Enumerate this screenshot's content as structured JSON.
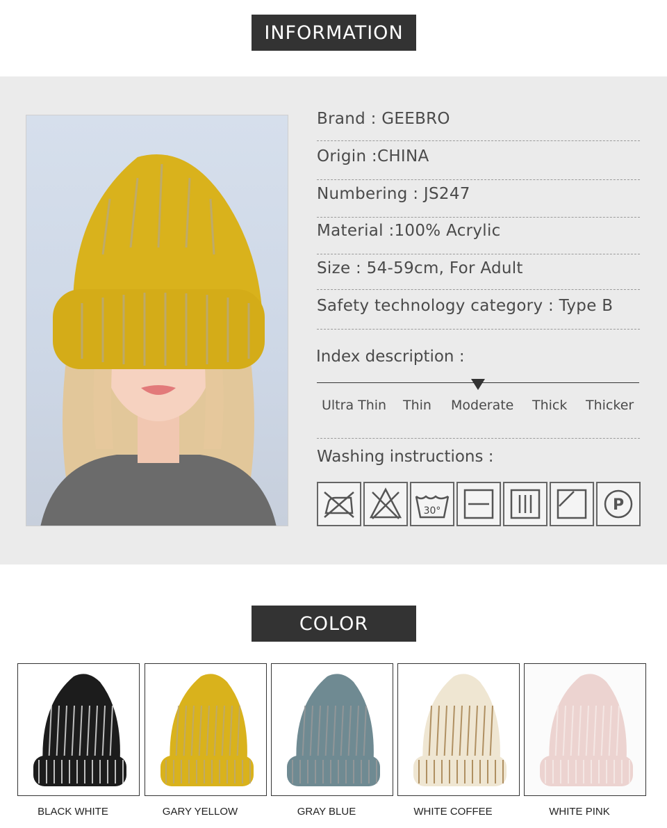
{
  "info_heading": "INFORMATION",
  "color_heading": "COLOR",
  "specs": [
    {
      "label": "Brand : GEEBRO"
    },
    {
      "label": "Origin :CHINA"
    },
    {
      "label": "Numbering : JS247"
    },
    {
      "label": "Material :100% Acrylic"
    },
    {
      "label": "Size : 54-59cm, For Adult"
    },
    {
      "label": "Safety technology category : Type B"
    }
  ],
  "index": {
    "title": "Index description :",
    "levels": [
      "Ultra Thin",
      "Thin",
      "Moderate",
      "Thick",
      "Thicker"
    ],
    "selected": "Moderate"
  },
  "washing": {
    "title": "Washing instructions :",
    "icons": [
      {
        "name": "do-not-iron-icon"
      },
      {
        "name": "do-not-bleach-icon"
      },
      {
        "name": "wash-30-icon",
        "text": "30°"
      },
      {
        "name": "dry-flat-icon"
      },
      {
        "name": "drip-dry-icon"
      },
      {
        "name": "dry-in-shade-icon"
      },
      {
        "name": "dry-clean-p-icon",
        "text": "P"
      }
    ]
  },
  "colors": [
    {
      "label": "BLACK WHITE",
      "hat": "#1c1c1c",
      "fleck": "#e8e8e8"
    },
    {
      "label": "GARY YELLOW",
      "hat": "#d9b21c",
      "fleck": "#b9a878"
    },
    {
      "label": "GRAY BLUE",
      "hat": "#6f8a92",
      "fleck": "#9a9a9a"
    },
    {
      "label": "WHITE COFFEE",
      "hat": "#efe6d2",
      "fleck": "#a07a45"
    },
    {
      "label": "WHITE PINK",
      "hat": "#ecd3d0",
      "fleck": "#f7ecea"
    }
  ],
  "colors_theme": {
    "tag_bg": "#333333",
    "band_bg": "#ebebeb"
  }
}
